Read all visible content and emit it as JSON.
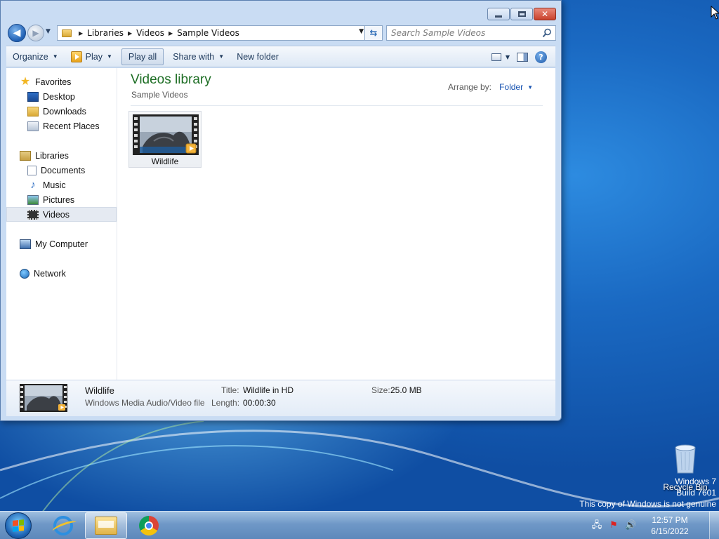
{
  "window": {
    "address": {
      "crumbs": [
        "Libraries",
        "Videos",
        "Sample Videos"
      ]
    },
    "search": {
      "placeholder": "Search Sample Videos"
    },
    "toolbar": {
      "organize": "Organize",
      "play": "Play",
      "play_all": "Play all",
      "share_with": "Share with",
      "new_folder": "New folder"
    },
    "nav": {
      "favorites": "Favorites",
      "desktop": "Desktop",
      "downloads": "Downloads",
      "recent_places": "Recent Places",
      "libraries": "Libraries",
      "documents": "Documents",
      "music": "Music",
      "pictures": "Pictures",
      "videos": "Videos",
      "my_computer": "My Computer",
      "network": "Network"
    },
    "main": {
      "title": "Videos library",
      "subtitle": "Sample Videos",
      "arrange_label": "Arrange by:",
      "arrange_value": "Folder",
      "items": [
        {
          "label": "Wildlife"
        }
      ]
    },
    "details": {
      "name": "Wildlife",
      "type": "Windows Media Audio/Video file",
      "title_key": "Title:",
      "title_value": "Wildlife in HD",
      "length_key": "Length:",
      "length_value": "00:00:30",
      "size_key": "Size:",
      "size_value": "25.0 MB"
    }
  },
  "desktop": {
    "recycle_bin": "Recycle Bin",
    "watermark": [
      "Windows 7",
      "Build 7601",
      "This copy of Windows is not genuine"
    ]
  },
  "taskbar": {
    "clock_time": "12:57 PM",
    "clock_date": "6/15/2022",
    "pinned": [
      "internet-explorer-icon",
      "windows-explorer-icon",
      "chrome-icon"
    ]
  },
  "colors": {
    "library_title": "#1e6e25",
    "link_blue": "#1a55b2",
    "desktop_blue": "#1a69c2"
  }
}
